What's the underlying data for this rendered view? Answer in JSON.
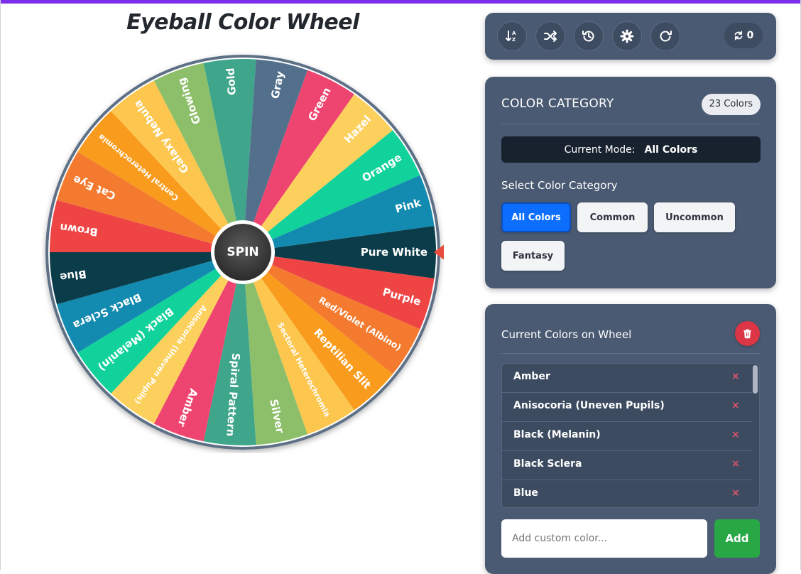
{
  "title": "Eyeball Color Wheel",
  "wheel": {
    "spin_label": "SPIN",
    "segments": [
      {
        "label": "Pure White",
        "color": "#0b3c49"
      },
      {
        "label": "Purple",
        "color": "#ef4444"
      },
      {
        "label": "Red/Violet (Albino)",
        "color": "#f37a2e"
      },
      {
        "label": "Reptilian Slit",
        "color": "#f99b1c"
      },
      {
        "label": "Sectoral Heterochromia",
        "color": "#fcc64f"
      },
      {
        "label": "Silver",
        "color": "#8dbf6a"
      },
      {
        "label": "Spiral Pattern",
        "color": "#3fa58b"
      },
      {
        "label": "Amber",
        "color": "#ee4570"
      },
      {
        "label": "Anisocoria (Uneven Pupils)",
        "color": "#fcd05c"
      },
      {
        "label": "Black (Melanin)",
        "color": "#11d29a"
      },
      {
        "label": "Black Sclera",
        "color": "#138aaf"
      },
      {
        "label": "Blue",
        "color": "#0b3c49"
      },
      {
        "label": "Brown",
        "color": "#ef4444"
      },
      {
        "label": "Cat Eye",
        "color": "#f37a2e"
      },
      {
        "label": "Central Heterochromia",
        "color": "#f99b1c"
      },
      {
        "label": "Galaxy Nebula",
        "color": "#fcc64f"
      },
      {
        "label": "Glowing",
        "color": "#8dbf6a"
      },
      {
        "label": "Gold",
        "color": "#3fa58b"
      },
      {
        "label": "Gray",
        "color": "#52708c"
      },
      {
        "label": "Green",
        "color": "#ee4570"
      },
      {
        "label": "Hazel",
        "color": "#fcd05c"
      },
      {
        "label": "Orange",
        "color": "#11d29a"
      },
      {
        "label": "Pink",
        "color": "#138aaf"
      }
    ],
    "pointer_color": "#e74c3c",
    "rim_color": "#5d6f86"
  },
  "toolbar": {
    "buttons": [
      {
        "icon": "sort-icon"
      },
      {
        "icon": "shuffle-icon"
      },
      {
        "icon": "history-icon"
      },
      {
        "icon": "gear-icon"
      },
      {
        "icon": "redo-icon"
      }
    ],
    "spin_count": "0"
  },
  "category": {
    "title": "COLOR CATEGORY",
    "count_badge": "23 Colors",
    "mode_label": "Current Mode:",
    "mode_value": "All Colors",
    "select_label": "Select Color Category",
    "buttons": [
      {
        "label": "All Colors",
        "active": true
      },
      {
        "label": "Common",
        "active": false
      },
      {
        "label": "Uncommon",
        "active": false
      },
      {
        "label": "Fantasy",
        "active": false
      }
    ]
  },
  "colors_panel": {
    "title": "Current Colors on Wheel",
    "items": [
      {
        "name": "Amber",
        "remove": "×"
      },
      {
        "name": "Anisocoria (Uneven Pupils)",
        "remove": "×"
      },
      {
        "name": "Black (Melanin)",
        "remove": "×"
      },
      {
        "name": "Black Sclera",
        "remove": "×"
      },
      {
        "name": "Blue",
        "remove": "×"
      }
    ],
    "input_placeholder": "Add custom color...",
    "add_label": "Add"
  }
}
